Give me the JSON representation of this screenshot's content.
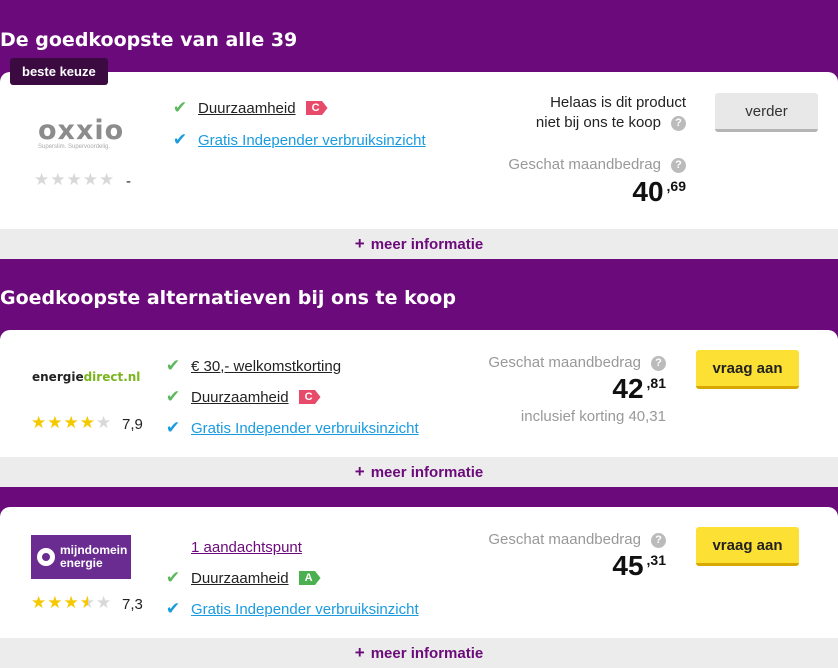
{
  "sections": {
    "cheapest_title": "De goedkoopste van alle 39",
    "alternatives_title": "Goedkoopste alternatieven bij ons te koop"
  },
  "top_offer": {
    "badge": "beste keuze",
    "logo_text": "oxxio",
    "logo_tagline": "Superslim. Supervoordelig.",
    "rating": "-",
    "stars": 0,
    "features": {
      "sustainability": "Duurzaamheid",
      "sustainability_label": "C",
      "insight": "Gratis Independer verbruiksinzicht"
    },
    "unavailable_line1": "Helaas is dit product",
    "unavailable_line2": "niet bij ons te koop",
    "estimate_label": "Geschat maandbedrag",
    "price_main": "40",
    "price_cents": ",69",
    "button": "verder",
    "more": "meer informatie"
  },
  "offers": [
    {
      "logo_text_a": "energie",
      "logo_text_b": "direct.nl",
      "rating": "7,9",
      "stars": 4,
      "feature1": "€ 30,- welkomstkorting",
      "sustainability": "Duurzaamheid",
      "sustainability_label": "C",
      "insight": "Gratis Independer verbruiksinzicht",
      "estimate_label": "Geschat maandbedrag",
      "price_main": "42",
      "price_cents": ",81",
      "discount_note": "inclusief korting 40,31",
      "button": "vraag aan",
      "more": "meer informatie"
    },
    {
      "logo_text_a": "mijndomein",
      "logo_text_b": "energie",
      "rating": "7,3",
      "stars": 3.5,
      "feature1": "1 aandachtspunt",
      "sustainability": "Duurzaamheid",
      "sustainability_label": "A",
      "insight": "Gratis Independer verbruiksinzicht",
      "estimate_label": "Geschat maandbedrag",
      "price_main": "45",
      "price_cents": ",31",
      "button": "vraag aan",
      "more": "meer informatie"
    }
  ],
  "colors": {
    "background": "#6b0a7a",
    "cta_yellow": "#fde034",
    "check_green": "#5cb85c",
    "link_blue": "#1a9be0",
    "label_c": "#e84a6a",
    "label_a": "#4caf50"
  },
  "icons": {
    "check": "check-icon",
    "help": "question-icon",
    "plus": "plus-icon",
    "star": "star-icon"
  }
}
